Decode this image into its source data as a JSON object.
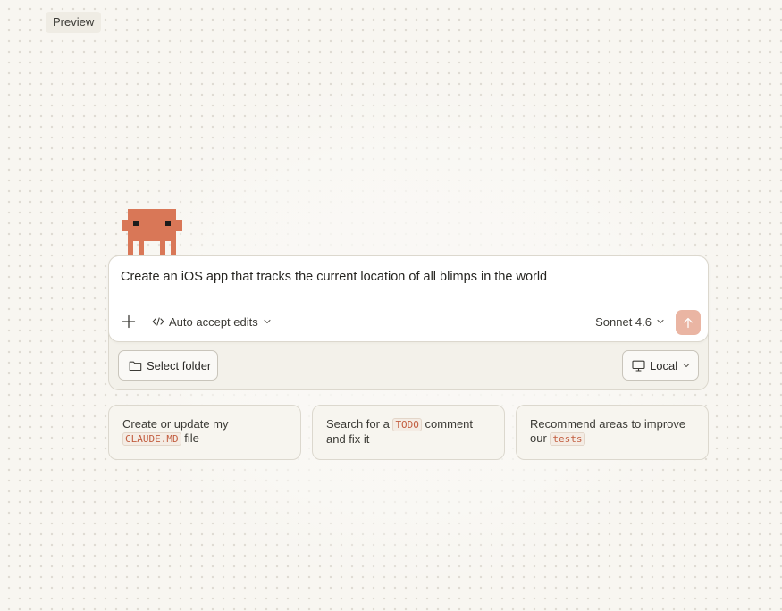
{
  "window": {
    "preview_label": "Preview"
  },
  "composer": {
    "prompt_text": "Create an iOS app that tracks the current location of all blimps in the world",
    "mode_label": "Auto accept edits",
    "model_label": "Sonnet 4.6",
    "select_folder_label": "Select folder",
    "environment_label": "Local"
  },
  "suggestions": [
    {
      "prefix": "Create or update my ",
      "code": "CLAUDE.MD",
      "suffix": " file"
    },
    {
      "prefix": "Search for a ",
      "code": "TODO",
      "suffix": " comment and fix it"
    },
    {
      "prefix": "Recommend areas to improve our ",
      "code": "tests",
      "suffix": ""
    }
  ],
  "icons": {
    "add": "plus-icon",
    "mode": "code-brackets-icon",
    "chevron": "chevron-down-icon",
    "send": "arrow-up-icon",
    "folder": "folder-icon",
    "environment": "monitor-icon",
    "mascot": "pixel-creature-icon"
  },
  "colors": {
    "accent": "#d97757",
    "send_button": "#eab5a3",
    "background": "#f8f6f1"
  }
}
